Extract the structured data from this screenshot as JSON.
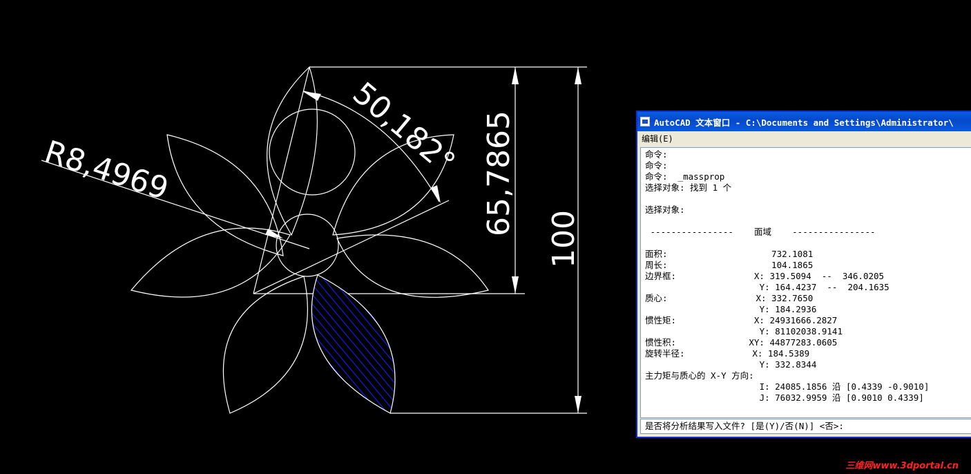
{
  "drawing": {
    "radius_label": "R8,4969",
    "angle_label": "50,182°",
    "dim_vertical_1": "65,7865",
    "dim_vertical_2": "100",
    "line_color": "#ffffff",
    "hatch_color": "#1a1aff"
  },
  "text_window": {
    "title": "AutoCAD 文本窗口 - C:\\Documents and Settings\\Administrator\\",
    "menu_edit": "编辑(E)",
    "lines": [
      "命令:",
      "命令:",
      "命令:  _massprop",
      "选择对象: 找到 1 个",
      "",
      "选择对象:",
      "",
      " ----------------    面域    ----------------",
      "",
      "面积:                    732.1081",
      "周长:                    104.1865",
      "边界框:               X: 319.5094  --  346.0205",
      "                      Y: 164.4237  --  204.1635",
      "质心:                 X: 332.7650",
      "                      Y: 184.2936",
      "惯性矩:               X: 24931666.2827",
      "                      Y: 81102038.9141",
      "惯性积:              XY: 44877283.0605",
      "旋转半径:             X: 184.5389",
      "                      Y: 332.8344",
      "主力矩与质心的 X-Y 方向:",
      "                      I: 24085.1856 沿 [0.4339 -0.9010]",
      "                      J: 76032.9959 沿 [0.9010 0.4339]"
    ],
    "prompt": "是否将分析结果写入文件? [是(Y)/否(N)] <否>:"
  },
  "watermark": "三维网www.3dportal.cn",
  "colors": {
    "background": "#000000",
    "title_bar": "#0a5fe4",
    "window_face": "#ece9d8",
    "watermark": "#ff2222"
  }
}
